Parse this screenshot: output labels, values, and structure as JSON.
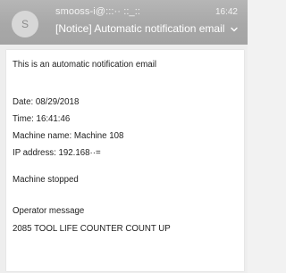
{
  "notification": {
    "avatar_letter": "S",
    "sender": "smooss-i@:::·· ::_::",
    "time": "16:42",
    "subject": "[Notice] Automatic notification email",
    "chevron_icon": "chevron-down-icon"
  },
  "message": {
    "intro": "This is an automatic notification email",
    "date": "Date: 08/29/2018",
    "time": "Time: 16:41:46",
    "machine_name": "Machine name: Machine 108",
    "ip_address": "IP address: 192.168··=",
    "status": "Machine stopped",
    "operator_label": "Operator message",
    "operator_text": "2085 TOOL LIFE COUNTER COUNT UP"
  }
}
